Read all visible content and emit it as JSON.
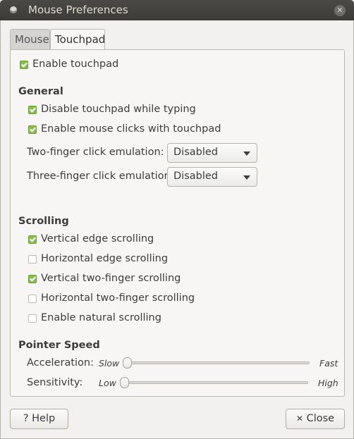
{
  "window": {
    "title": "Mouse Preferences"
  },
  "tabs": [
    {
      "label": "Mouse",
      "active": false
    },
    {
      "label": "Touchpad",
      "active": true
    }
  ],
  "touchpad": {
    "enable_touchpad": {
      "label": "Enable touchpad",
      "checked": true
    },
    "general": {
      "heading": "General",
      "disable_while_typing": {
        "label": "Disable touchpad while typing",
        "checked": true
      },
      "enable_mouse_clicks": {
        "label": "Enable mouse clicks with touchpad",
        "checked": true
      },
      "two_finger": {
        "label": "Two-finger click emulation:",
        "value": "Disabled"
      },
      "three_finger": {
        "label": "Three-finger click emulation:",
        "value": "Disabled"
      }
    },
    "scrolling": {
      "heading": "Scrolling",
      "vertical_edge": {
        "label": "Vertical edge scrolling",
        "checked": true
      },
      "horizontal_edge": {
        "label": "Horizontal edge scrolling",
        "checked": false
      },
      "vertical_two_finger": {
        "label": "Vertical two-finger scrolling",
        "checked": true
      },
      "horizontal_two_finger": {
        "label": "Horizontal two-finger scrolling",
        "checked": false
      },
      "natural": {
        "label": "Enable natural scrolling",
        "checked": false
      }
    },
    "pointer_speed": {
      "heading": "Pointer Speed",
      "acceleration": {
        "label": "Acceleration:",
        "min_label": "Slow",
        "max_label": "Fast",
        "level": 0
      },
      "sensitivity": {
        "label": "Sensitivity:",
        "min_label": "Low",
        "max_label": "High",
        "level": 0
      }
    }
  },
  "footer": {
    "help_label": "Help",
    "help_icon": "?",
    "close_label": "Close",
    "close_icon": "✕"
  },
  "colors": {
    "check_on": "#8abc4f",
    "titlebar": "#3c3b37"
  }
}
